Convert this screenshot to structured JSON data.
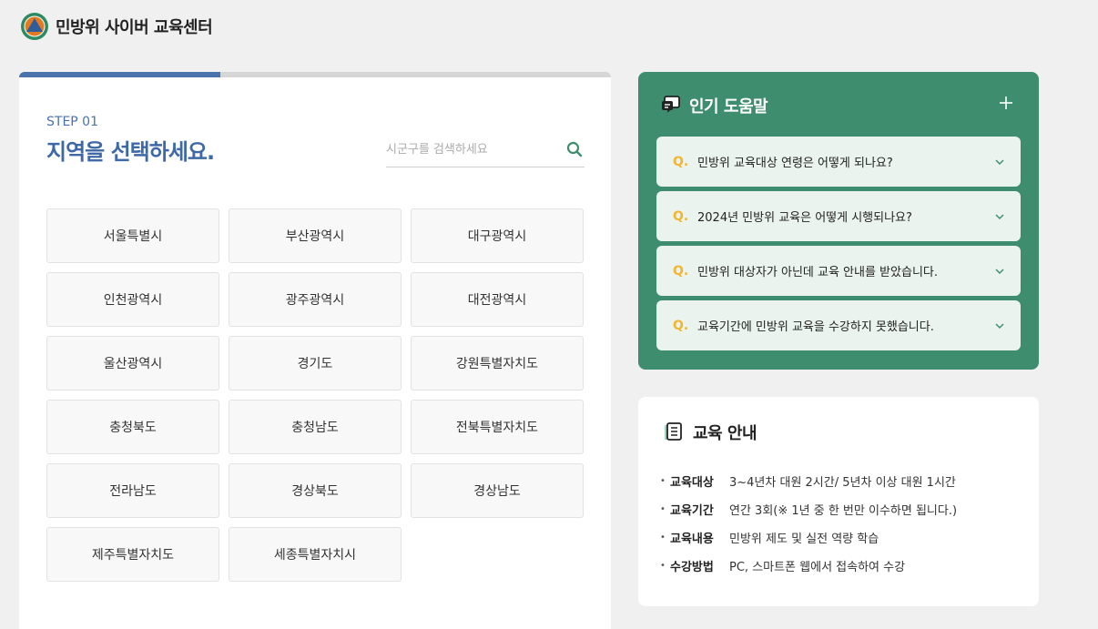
{
  "header": {
    "site_title": "민방위 사이버 교육센터",
    "logo_icon": "civil-defense-logo"
  },
  "step": {
    "progress_percent": 34,
    "label": "STEP 01",
    "title": "지역을 선택하세요.",
    "search_placeholder": "시군구를 검색하세요",
    "search_value": ""
  },
  "regions": [
    "서울특별시",
    "부산광역시",
    "대구광역시",
    "인천광역시",
    "광주광역시",
    "대전광역시",
    "울산광역시",
    "경기도",
    "강원특별자치도",
    "충청북도",
    "충청남도",
    "전북특별자치도",
    "전라남도",
    "경상북도",
    "경상남도",
    "제주특별자치도",
    "세종특별자치시"
  ],
  "faq": {
    "title": "인기 도움말",
    "q_mark": "Q.",
    "items": [
      "민방위 교육대상 연령은 어떻게 되나요?",
      "2024년 민방위 교육은 어떻게 시행되나요?",
      "민방위 대상자가 아닌데 교육 안내를 받았습니다.",
      "교육기간에 민방위 교육을 수강하지 못했습니다."
    ]
  },
  "education": {
    "title": "교육 안내",
    "bullet": "•",
    "rows": [
      {
        "label": "교육대상",
        "value": "3~4년차 대원 2시간/ 5년차 이상 대원 1시간"
      },
      {
        "label": "교육기간",
        "value": "연간 3회(※ 1년 중 한 번만 이수하면 됩니다.)"
      },
      {
        "label": "교육내용",
        "value": "민방위 제도 및 실전 역량 학습"
      },
      {
        "label": "수강방법",
        "value": "PC, 스마트폰 웹에서 접속하여 수강"
      }
    ]
  },
  "colors": {
    "accent_blue": "#3f69a6",
    "faq_green": "#3d8d6e",
    "q_yellow": "#f2b531",
    "logo_orange": "#e4791f"
  }
}
